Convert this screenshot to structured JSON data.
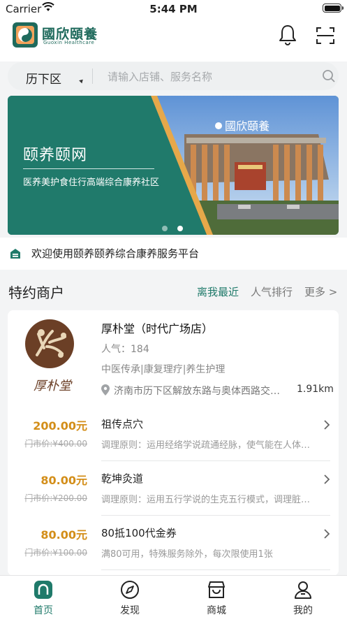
{
  "status_bar": {
    "carrier": "Carrier",
    "time": "5:44 PM"
  },
  "header": {
    "logo_text": "國欣頤養",
    "logo_sub": "Guoxin Healthcare",
    "icons": [
      "bell-icon",
      "scan-icon"
    ]
  },
  "search": {
    "district": "历下区",
    "placeholder": "请输入店铺、服务名称"
  },
  "banner": {
    "title": "颐养颐网",
    "slogan": "医养美护食住行高端综合康养社区",
    "building_sign": "國欣頤養",
    "slide_count": 2,
    "active_slide": 2
  },
  "notice": {
    "text": "欢迎使用颐养颐养综合康养服务平台"
  },
  "section": {
    "title": "特约商户",
    "tabs": [
      {
        "label": "离我最近",
        "active": true
      },
      {
        "label": "人气排行",
        "active": false
      },
      {
        "label": "更多 >",
        "active": false
      }
    ]
  },
  "merchant": {
    "name": "厚朴堂（时代广场店）",
    "popularity": "人气：184",
    "tags": "中医传承|康复理疗|养生护理",
    "address": "济南市历下区解放东路与奥体西路交叉口时代广场",
    "distance": "1.91km",
    "logo_text": "厚朴堂",
    "services": [
      {
        "price": "200.00元",
        "original": "门市价:¥400.00",
        "name": "祖传点穴",
        "desc": "调理原则：运用经络学说疏通经脉，使气能在人体内顺畅运行"
      },
      {
        "price": "80.00元",
        "original": "门市价:¥200.00",
        "name": "乾坤灸道",
        "desc": "调理原则：运用五行学说的生克五行模式，调理脏腑平衡"
      },
      {
        "price": "80.00元",
        "original": "门市价:¥100.00",
        "name": "80抵100代金券",
        "desc": "满80可用，特殊服务除外，每次限使用1张"
      }
    ]
  },
  "tabbar": {
    "items": [
      {
        "label": "首页",
        "icon": "home-icon",
        "active": true
      },
      {
        "label": "发现",
        "icon": "compass-icon",
        "active": false
      },
      {
        "label": "商城",
        "icon": "store-icon",
        "active": false
      },
      {
        "label": "我的",
        "icon": "user-icon",
        "active": false
      }
    ]
  },
  "colors": {
    "brand": "#1f7a6a",
    "price": "#d38e19",
    "background": "#f3f4f5"
  }
}
